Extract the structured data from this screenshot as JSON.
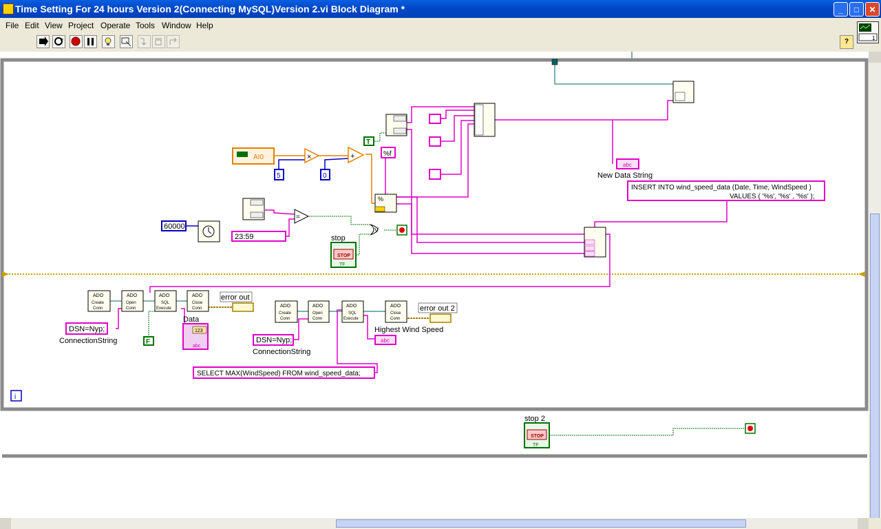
{
  "window": {
    "title": "Time Setting For 24 hours Version 2(Connecting MySQL)Version 2.vi Block Diagram *",
    "minimize": "_",
    "maximize": "□",
    "close": "✕"
  },
  "menu": [
    "File",
    "Edit",
    "View",
    "Project",
    "Operate",
    "Tools",
    "Window",
    "Help"
  ],
  "toolbar": {
    "run_icon": "run-arrow-icon",
    "help": "?"
  },
  "diagram": {
    "constants": {
      "ai0": "AI0",
      "five": "5",
      "zero": "0",
      "true_const": "T",
      "false_const": "F",
      "format_f": "%f",
      "wait_ms": "60000",
      "time_match": "23:59",
      "dsn1": "DSN=Nyp;",
      "dsn2": "DSN=Nyp;"
    },
    "sql": {
      "insert_line1": "INSERT INTO wind_speed_data (Date, Time, WindSpeed )",
      "insert_line2": "VALUES ( '%s', '%s' , '%s' );",
      "select": "SELECT MAX(WindSpeed)  FROM wind_speed_data;"
    },
    "labels": {
      "stop": "stop",
      "stop2": "stop 2",
      "new_data_string": "New Data String",
      "data": "Data",
      "highest_wind_speed": "Highest Wind Speed",
      "connection_string_1": "ConnectionString",
      "connection_string_2": "ConnectionString",
      "error_out": "error out",
      "error_out_2": "error out 2",
      "iteration": "i"
    },
    "ado": {
      "ado": "ADO",
      "create1": "Create",
      "create2": "Conn",
      "open1": "Open",
      "open2": "Conn",
      "sql1": "SQL",
      "sql2": "Execute",
      "close1": "Close",
      "close2": "Conn"
    },
    "stop_button": "STOP",
    "tf": "TF",
    "abc": "abc",
    "or_symbol": "V",
    "num_display": "123"
  },
  "colors": {
    "titlebar": "#0054e3",
    "string_wire": "#e000c8",
    "numeric_orange": "#e67e00",
    "numeric_blue": "#0000c0",
    "boolean_green": "#007000",
    "structure_gray": "#808080",
    "error_wire": "#a08000",
    "ref_wire": "#006060"
  }
}
